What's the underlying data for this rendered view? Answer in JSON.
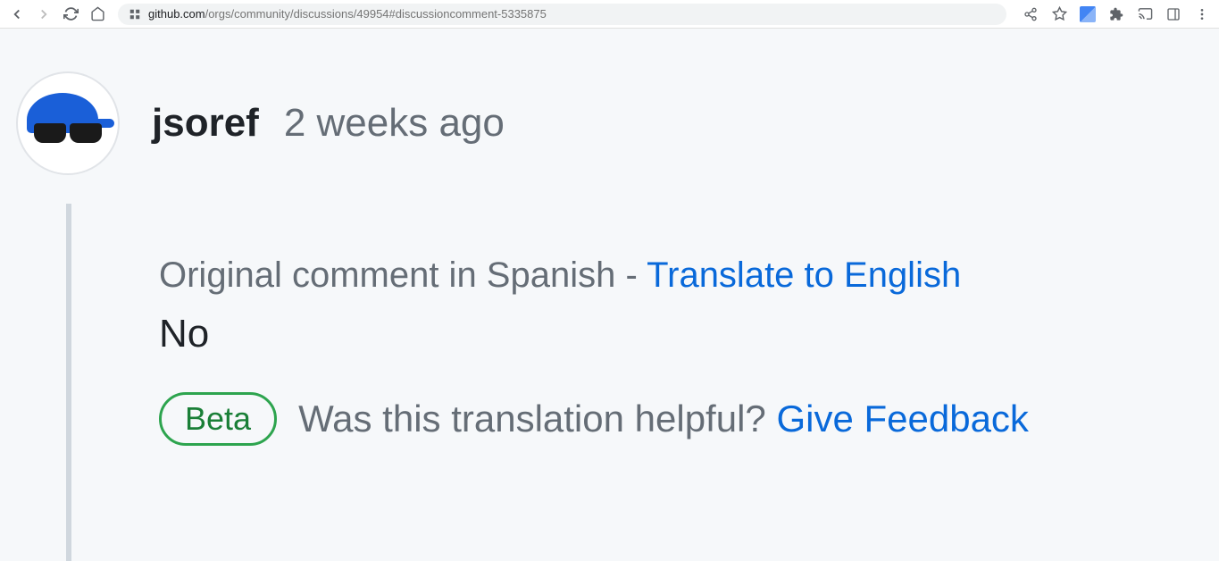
{
  "browser": {
    "url_domain": "github.com",
    "url_path": "/orgs/community/discussions/49954#discussioncomment-5335875"
  },
  "comment": {
    "author": "jsoref",
    "timestamp": "2 weeks ago",
    "translate_prompt": "Original comment in Spanish - ",
    "translate_link": "Translate to English",
    "body": "No",
    "beta_label": "Beta",
    "feedback_prompt": "Was this translation helpful? ",
    "feedback_link": "Give Feedback"
  }
}
